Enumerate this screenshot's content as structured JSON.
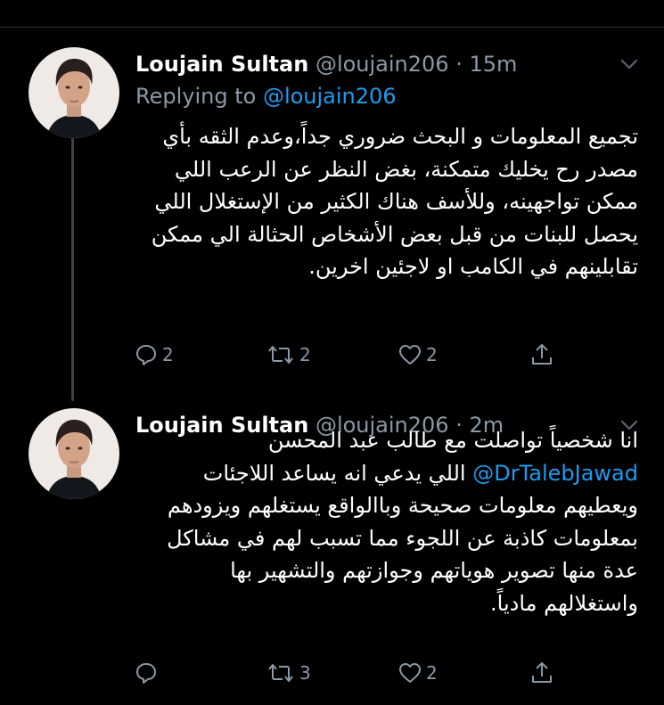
{
  "thread": [
    {
      "name": "Loujain Sultan",
      "handle": "@loujain206",
      "separator": "·",
      "time": "15m",
      "replying_prefix": "Replying to",
      "replying_to": "@loujain206",
      "body": "تجميع المعلومات و البحث ضروري جداً،وعدم الثقه بأي مصدر رح يخليك متمكنة، بغض النظر عن الرعب اللي ممكن تواجهينه، وللأسف هناك الكثير من الإستغلال اللي يحصل للبنات من قبل بعض الأشخاص الحثالة الي ممكن تقابلينهم في الكامب او لاجئين اخرين.",
      "replies": "2",
      "retweets": "2",
      "likes": "2"
    },
    {
      "name": "Loujain Sultan",
      "handle": "@loujain206",
      "separator": "·",
      "time": "2m",
      "body_part1": "انا شخصياً تواصلت مع طالب عبد المحسن",
      "body_mention": "@DrTalebJawad",
      "body_part2": "اللي يدعي انه يساعد اللاجئات ويعطيهم معلومات صحيحة وباالواقع يستغلهم ويزودهم بمعلومات كاذبة عن اللجوء مما تسبب لهم في مشاكل عدة منها تصوير هوياتهم وجوازتهم والتشهير بها واستغلالهم مادياً.",
      "replies": "",
      "retweets": "3",
      "likes": "2"
    }
  ],
  "icons": {
    "reply": "speech-bubble-icon",
    "retweet": "retweet-arrows-icon",
    "like": "heart-icon",
    "share": "share-upload-icon",
    "more": "chevron-down-icon"
  },
  "colors": {
    "background": "#000000",
    "text": "#ffffff",
    "muted": "#8b98a5",
    "link": "#1d9bf0",
    "thread_line": "#3d4145"
  }
}
